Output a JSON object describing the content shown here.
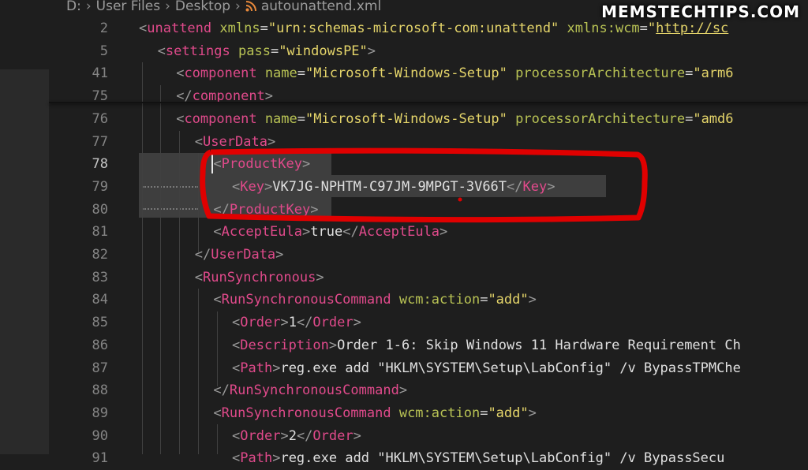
{
  "breadcrumb": {
    "drive": "D:",
    "folder1": "User Files",
    "folder2": "Desktop",
    "file": "autounattend.xml"
  },
  "watermark": "MEMSTECHTIPS.COM",
  "colors": {
    "tag": "#e04a8b",
    "attribute": "#b8c254",
    "value": "#e5d56a",
    "text": "#e0e0e0",
    "annotation": "#e00000"
  },
  "editor": {
    "lines": [
      {
        "num": "2",
        "indent": 0,
        "tokens": [
          [
            "b",
            "<"
          ],
          [
            "tag",
            "unattend"
          ],
          [
            "t",
            " "
          ],
          [
            "attr",
            "xmlns"
          ],
          [
            "eq",
            "="
          ],
          [
            "val",
            "\"urn:schemas-microsoft-com:unattend\""
          ],
          [
            "t",
            " "
          ],
          [
            "attr",
            "xmlns:wcm"
          ],
          [
            "eq",
            "="
          ],
          [
            "val",
            "\""
          ],
          [
            "url",
            "http://sc"
          ]
        ]
      },
      {
        "num": "5",
        "indent": 1,
        "tokens": [
          [
            "b",
            "<"
          ],
          [
            "tag",
            "settings"
          ],
          [
            "t",
            " "
          ],
          [
            "attr",
            "pass"
          ],
          [
            "eq",
            "="
          ],
          [
            "val",
            "\"windowsPE\""
          ],
          [
            "b",
            ">"
          ]
        ]
      },
      {
        "num": "41",
        "indent": 2,
        "tokens": [
          [
            "b",
            "<"
          ],
          [
            "tag",
            "component"
          ],
          [
            "t",
            " "
          ],
          [
            "attr",
            "name"
          ],
          [
            "eq",
            "="
          ],
          [
            "val",
            "\"Microsoft-Windows-Setup\""
          ],
          [
            "t",
            " "
          ],
          [
            "attr",
            "processorArchitecture"
          ],
          [
            "eq",
            "="
          ],
          [
            "val",
            "\"arm6"
          ]
        ]
      },
      {
        "num": "75",
        "indent": 2,
        "tokens": [
          [
            "b",
            "</"
          ],
          [
            "tag",
            "component"
          ],
          [
            "b",
            ">"
          ]
        ]
      },
      {
        "num": "76",
        "indent": 2,
        "tokens": [
          [
            "b",
            "<"
          ],
          [
            "tag",
            "component"
          ],
          [
            "t",
            " "
          ],
          [
            "attr",
            "name"
          ],
          [
            "eq",
            "="
          ],
          [
            "val",
            "\"Microsoft-Windows-Setup\""
          ],
          [
            "t",
            " "
          ],
          [
            "attr",
            "processorArchitecture"
          ],
          [
            "eq",
            "="
          ],
          [
            "val",
            "\"amd6"
          ]
        ]
      },
      {
        "num": "77",
        "indent": 3,
        "tokens": [
          [
            "b",
            "<"
          ],
          [
            "tag",
            "UserData"
          ],
          [
            "b",
            ">"
          ]
        ]
      },
      {
        "num": "78",
        "indent": 4,
        "active": true,
        "tokens": [
          [
            "b",
            "<"
          ],
          [
            "tag",
            "ProductKey"
          ],
          [
            "b",
            ">"
          ]
        ]
      },
      {
        "num": "79",
        "indent": 5,
        "tokens": [
          [
            "b",
            "<"
          ],
          [
            "tag",
            "Key"
          ],
          [
            "b",
            ">"
          ],
          [
            "text",
            "VK7JG-NPHTM-C97JM-9MPGT-3V66T"
          ],
          [
            "b",
            "</"
          ],
          [
            "tag",
            "Key"
          ],
          [
            "b",
            ">"
          ]
        ]
      },
      {
        "num": "80",
        "indent": 4,
        "tokens": [
          [
            "b",
            "</"
          ],
          [
            "tag",
            "ProductKey"
          ],
          [
            "b",
            ">"
          ]
        ]
      },
      {
        "num": "81",
        "indent": 4,
        "tokens": [
          [
            "b",
            "<"
          ],
          [
            "tag",
            "AcceptEula"
          ],
          [
            "b",
            ">"
          ],
          [
            "text",
            "true"
          ],
          [
            "b",
            "</"
          ],
          [
            "tag",
            "AcceptEula"
          ],
          [
            "b",
            ">"
          ]
        ]
      },
      {
        "num": "82",
        "indent": 3,
        "tokens": [
          [
            "b",
            "</"
          ],
          [
            "tag",
            "UserData"
          ],
          [
            "b",
            ">"
          ]
        ]
      },
      {
        "num": "83",
        "indent": 3,
        "tokens": [
          [
            "b",
            "<"
          ],
          [
            "tag",
            "RunSynchronous"
          ],
          [
            "b",
            ">"
          ]
        ]
      },
      {
        "num": "84",
        "indent": 4,
        "tokens": [
          [
            "b",
            "<"
          ],
          [
            "tag",
            "RunSynchronousCommand"
          ],
          [
            "t",
            " "
          ],
          [
            "attr",
            "wcm:action"
          ],
          [
            "eq",
            "="
          ],
          [
            "val",
            "\"add\""
          ],
          [
            "b",
            ">"
          ]
        ]
      },
      {
        "num": "85",
        "indent": 5,
        "tokens": [
          [
            "b",
            "<"
          ],
          [
            "tag",
            "Order"
          ],
          [
            "b",
            ">"
          ],
          [
            "text",
            "1"
          ],
          [
            "b",
            "</"
          ],
          [
            "tag",
            "Order"
          ],
          [
            "b",
            ">"
          ]
        ]
      },
      {
        "num": "86",
        "indent": 5,
        "tokens": [
          [
            "b",
            "<"
          ],
          [
            "tag",
            "Description"
          ],
          [
            "b",
            ">"
          ],
          [
            "text",
            "Order 1-6: Skip Windows 11 Hardware Requirement Ch"
          ]
        ]
      },
      {
        "num": "87",
        "indent": 5,
        "tokens": [
          [
            "b",
            "<"
          ],
          [
            "tag",
            "Path"
          ],
          [
            "b",
            ">"
          ],
          [
            "text",
            "reg.exe add \"HKLM\\SYSTEM\\Setup\\LabConfig\" /v BypassTPMChe"
          ]
        ]
      },
      {
        "num": "88",
        "indent": 4,
        "tokens": [
          [
            "b",
            "</"
          ],
          [
            "tag",
            "RunSynchronousCommand"
          ],
          [
            "b",
            ">"
          ]
        ]
      },
      {
        "num": "89",
        "indent": 4,
        "tokens": [
          [
            "b",
            "<"
          ],
          [
            "tag",
            "RunSynchronousCommand"
          ],
          [
            "t",
            " "
          ],
          [
            "attr",
            "wcm:action"
          ],
          [
            "eq",
            "="
          ],
          [
            "val",
            "\"add\""
          ],
          [
            "b",
            ">"
          ]
        ]
      },
      {
        "num": "90",
        "indent": 5,
        "tokens": [
          [
            "b",
            "<"
          ],
          [
            "tag",
            "Order"
          ],
          [
            "b",
            ">"
          ],
          [
            "text",
            "2"
          ],
          [
            "b",
            "</"
          ],
          [
            "tag",
            "Order"
          ],
          [
            "b",
            ">"
          ]
        ]
      },
      {
        "num": "91",
        "indent": 5,
        "tokens": [
          [
            "b",
            "<"
          ],
          [
            "tag",
            "Path"
          ],
          [
            "b",
            ">"
          ],
          [
            "text",
            "reg.exe add \"HKLM\\SYSTEM\\Setup\\LabConfig\" /v BypassSecu"
          ]
        ]
      }
    ]
  }
}
